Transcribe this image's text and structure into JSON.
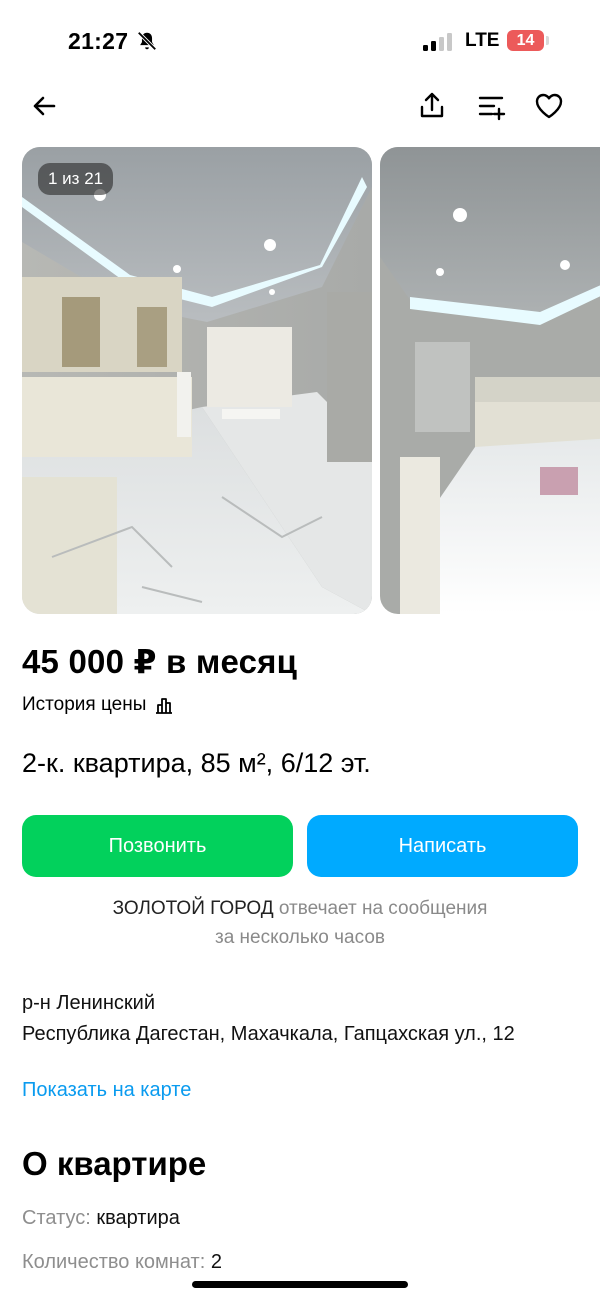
{
  "status_bar": {
    "time": "21:27",
    "network": "LTE",
    "battery": "14",
    "battery_color": "#ec5a5a"
  },
  "nav": {
    "back_icon": "arrow-left-icon",
    "share_icon": "share-icon",
    "compare_icon": "compare-list-icon",
    "favorite_icon": "heart-outline-icon"
  },
  "gallery": {
    "counter": "1 из 21"
  },
  "listing": {
    "price": "45 000 ₽ в месяц",
    "price_history": "История цены",
    "title": "2-к. квартира, 85 м², 6/12 эт."
  },
  "actions": {
    "call": "Позвонить",
    "write": "Написать",
    "call_color": "#02d15c",
    "write_color": "#00aaff"
  },
  "seller": {
    "name": "ЗОЛОТОЙ ГОРОД",
    "response_text": "отвечает на сообщения",
    "response_time": "за несколько часов"
  },
  "location": {
    "district": "р-н Ленинский",
    "address": "Республика Дагестан, Махачкала, Гапцахская ул., 12",
    "map_link": "Показать на карте",
    "link_color": "#0a9bef"
  },
  "about": {
    "title": "О квартире",
    "params": [
      {
        "label": "Статус: ",
        "value": "квартира"
      },
      {
        "label": "Количество комнат: ",
        "value": "2"
      }
    ]
  }
}
